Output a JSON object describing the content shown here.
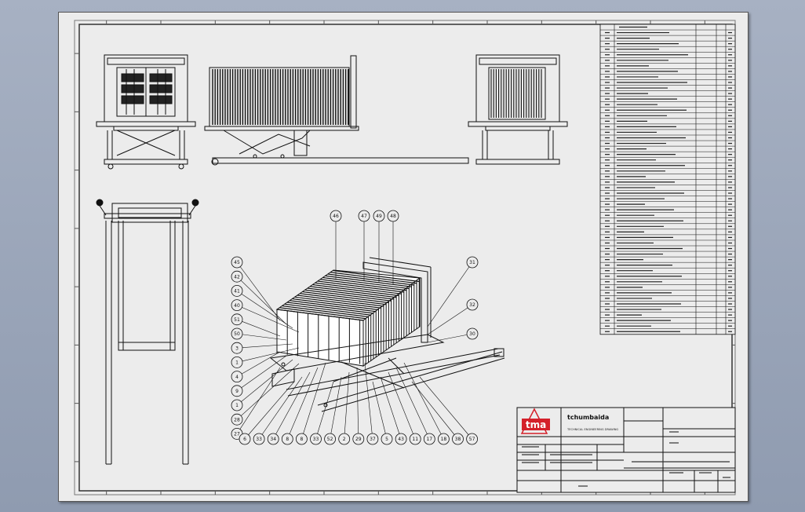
{
  "drawing": {
    "company_name": "tchumbaida",
    "company_subtitle": "TECHNICAL ENGINEERING DRAWING",
    "logo_text": "tma",
    "balloons_top": [
      "46",
      "47",
      "49",
      "48"
    ],
    "balloons_left": [
      "45",
      "42",
      "41",
      "40",
      "51",
      "50",
      "3",
      "1",
      "4",
      "9",
      "1",
      "28",
      "27"
    ],
    "balloons_right": [
      "31",
      "32",
      "30"
    ],
    "balloons_bottom": [
      "6",
      "33",
      "34",
      "8",
      "8",
      "33",
      "52",
      "2",
      "29",
      "37",
      "5",
      "43",
      "11",
      "17",
      "18",
      "38",
      "57"
    ],
    "bom_row_count": 55
  },
  "colors": {
    "background": "#98a3b7",
    "sheet": "#ececec",
    "line": "#111111",
    "logo_red": "#d4202a"
  }
}
